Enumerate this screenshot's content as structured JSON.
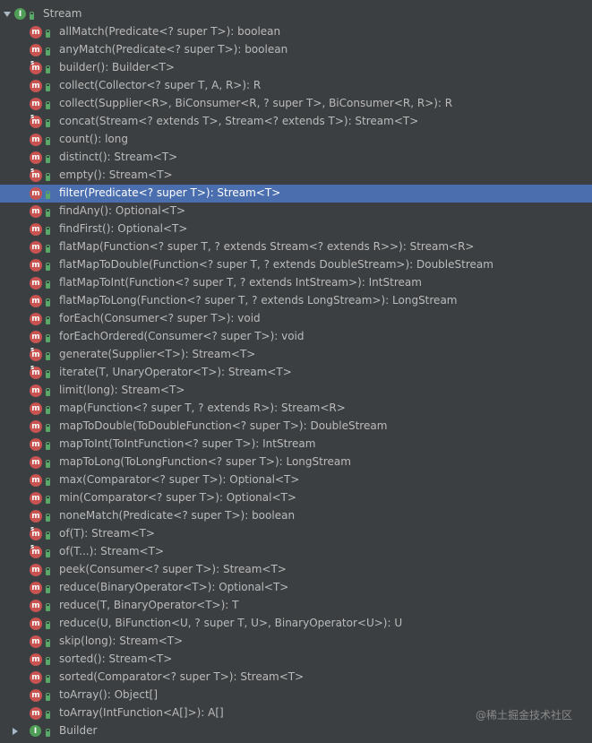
{
  "root": {
    "label": "Stream",
    "icon": "interface-icon"
  },
  "methods": [
    {
      "label": "allMatch(Predicate<? super T>): boolean",
      "static": false
    },
    {
      "label": "anyMatch(Predicate<? super T>): boolean",
      "static": false
    },
    {
      "label": "builder(): Builder<T>",
      "static": true
    },
    {
      "label": "collect(Collector<? super T, A, R>): R",
      "static": false
    },
    {
      "label": "collect(Supplier<R>, BiConsumer<R, ? super T>, BiConsumer<R, R>): R",
      "static": false
    },
    {
      "label": "concat(Stream<? extends T>, Stream<? extends T>): Stream<T>",
      "static": true
    },
    {
      "label": "count(): long",
      "static": false
    },
    {
      "label": "distinct(): Stream<T>",
      "static": false
    },
    {
      "label": "empty(): Stream<T>",
      "static": true
    },
    {
      "label": "filter(Predicate<? super T>): Stream<T>",
      "static": false,
      "selected": true
    },
    {
      "label": "findAny(): Optional<T>",
      "static": false
    },
    {
      "label": "findFirst(): Optional<T>",
      "static": false
    },
    {
      "label": "flatMap(Function<? super T, ? extends Stream<? extends R>>): Stream<R>",
      "static": false
    },
    {
      "label": "flatMapToDouble(Function<? super T, ? extends DoubleStream>): DoubleStream",
      "static": false
    },
    {
      "label": "flatMapToInt(Function<? super T, ? extends IntStream>): IntStream",
      "static": false
    },
    {
      "label": "flatMapToLong(Function<? super T, ? extends LongStream>): LongStream",
      "static": false
    },
    {
      "label": "forEach(Consumer<? super T>): void",
      "static": false
    },
    {
      "label": "forEachOrdered(Consumer<? super T>): void",
      "static": false
    },
    {
      "label": "generate(Supplier<T>): Stream<T>",
      "static": true
    },
    {
      "label": "iterate(T, UnaryOperator<T>): Stream<T>",
      "static": true
    },
    {
      "label": "limit(long): Stream<T>",
      "static": false
    },
    {
      "label": "map(Function<? super T, ? extends R>): Stream<R>",
      "static": false
    },
    {
      "label": "mapToDouble(ToDoubleFunction<? super T>): DoubleStream",
      "static": false
    },
    {
      "label": "mapToInt(ToIntFunction<? super T>): IntStream",
      "static": false
    },
    {
      "label": "mapToLong(ToLongFunction<? super T>): LongStream",
      "static": false
    },
    {
      "label": "max(Comparator<? super T>): Optional<T>",
      "static": false
    },
    {
      "label": "min(Comparator<? super T>): Optional<T>",
      "static": false
    },
    {
      "label": "noneMatch(Predicate<? super T>): boolean",
      "static": false
    },
    {
      "label": "of(T): Stream<T>",
      "static": true
    },
    {
      "label": "of(T...): Stream<T>",
      "static": true
    },
    {
      "label": "peek(Consumer<? super T>): Stream<T>",
      "static": false
    },
    {
      "label": "reduce(BinaryOperator<T>): Optional<T>",
      "static": false
    },
    {
      "label": "reduce(T, BinaryOperator<T>): T",
      "static": false
    },
    {
      "label": "reduce(U, BiFunction<U, ? super T, U>, BinaryOperator<U>): U",
      "static": false
    },
    {
      "label": "skip(long): Stream<T>",
      "static": false
    },
    {
      "label": "sorted(): Stream<T>",
      "static": false
    },
    {
      "label": "sorted(Comparator<? super T>): Stream<T>",
      "static": false
    },
    {
      "label": "toArray(): Object[]",
      "static": false
    },
    {
      "label": "toArray(IntFunction<A[]>): A[]",
      "static": false
    }
  ],
  "nested": {
    "label": "Builder",
    "icon": "interface-icon"
  },
  "watermark": "@稀土掘金技术社区",
  "colors": {
    "background": "#3c3f41",
    "selection": "#4b6eaf",
    "method_icon": "#c75450",
    "interface_icon": "#4f9d57",
    "text": "#bbbbbb"
  }
}
